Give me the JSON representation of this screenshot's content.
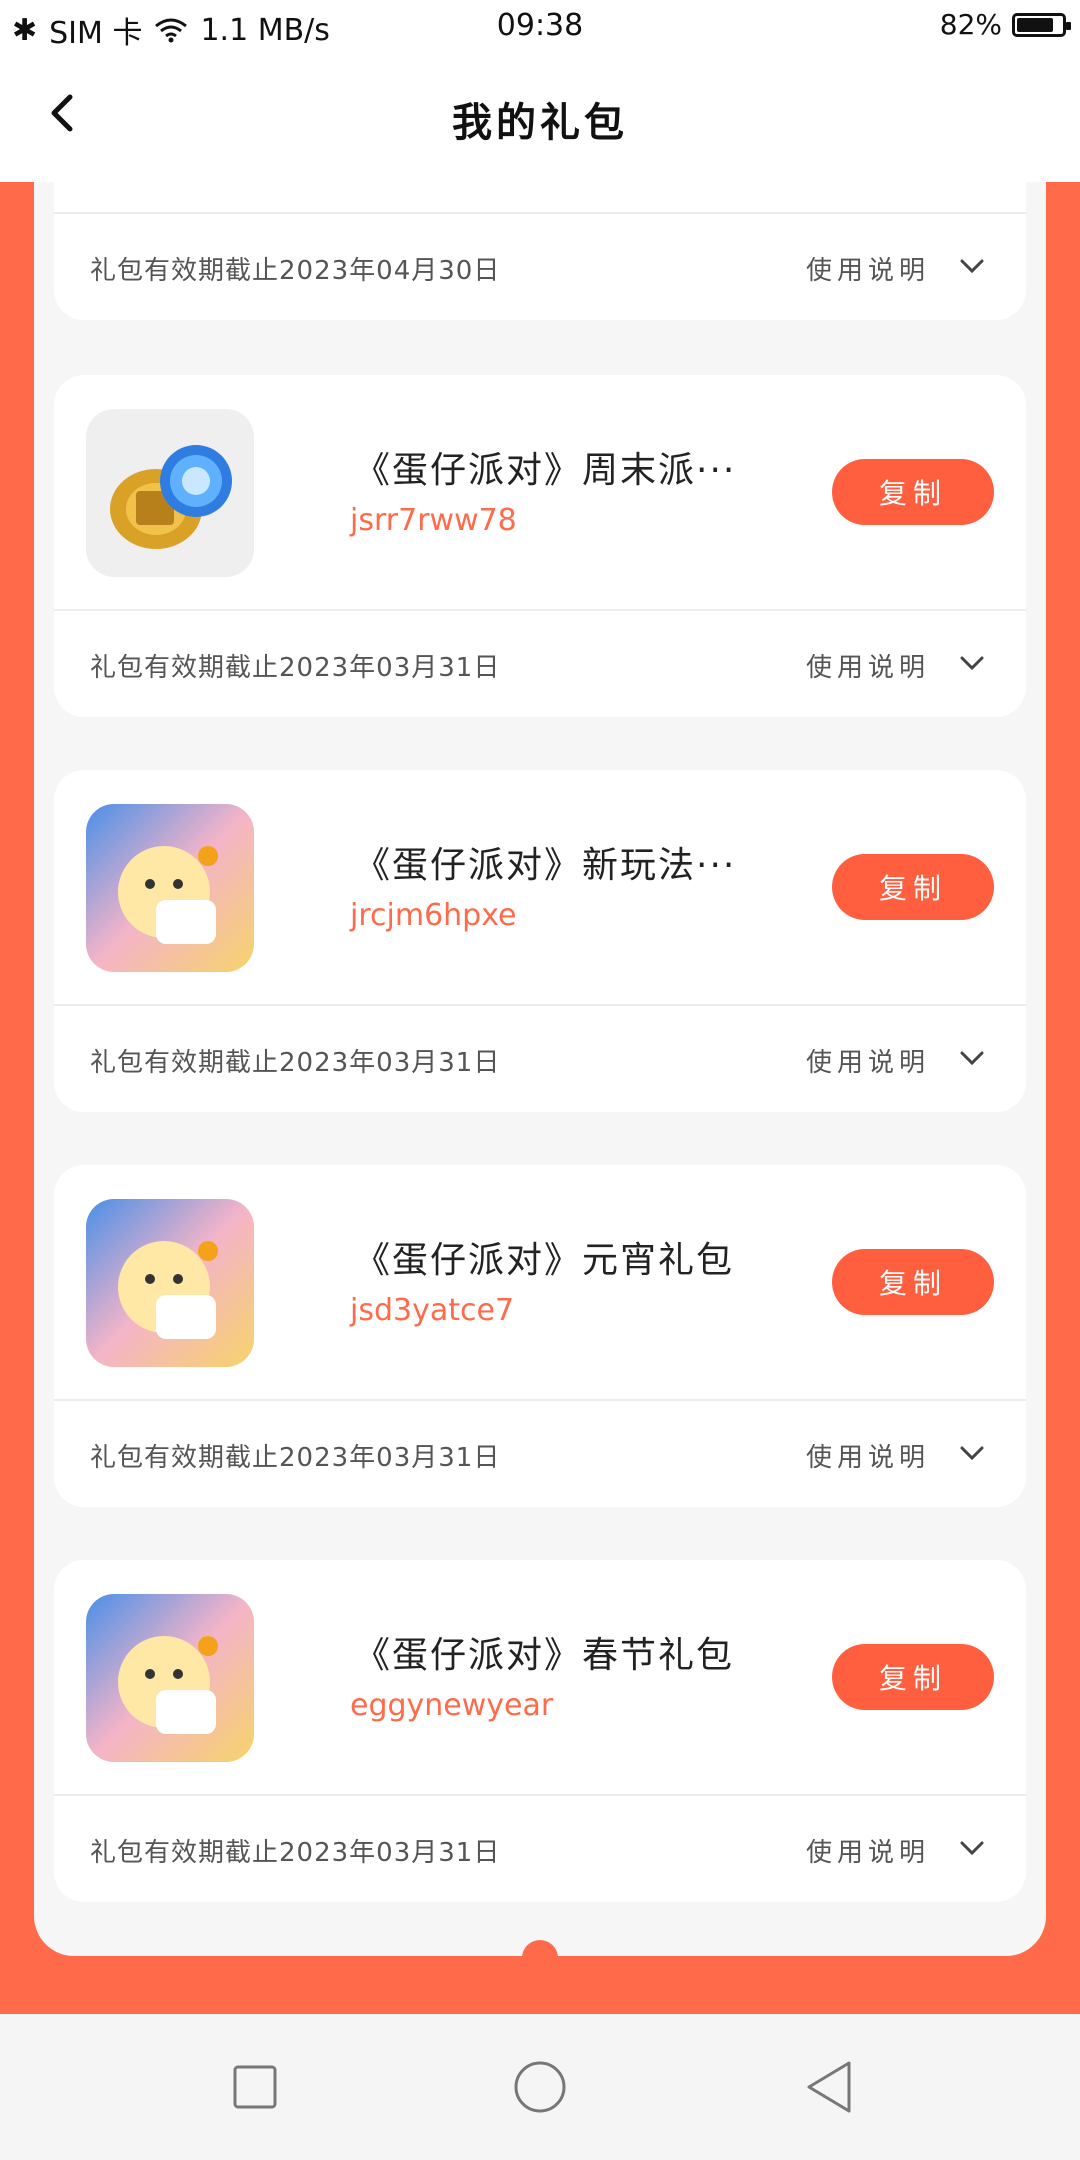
{
  "status_bar": {
    "sim": "SIM 卡",
    "speed": "1.1 MB/s",
    "time": "09:38",
    "battery_text": "82%",
    "battery_level": 0.82
  },
  "header": {
    "title": "我的礼包"
  },
  "first_card": {
    "expiry": "礼包有效期截止2023年04月30日",
    "usage": "使用说明"
  },
  "gifts": [
    {
      "icon": "gold-gear-crystal-icon",
      "title": "《蛋仔派对》周末派···",
      "code": "jsrr7rww78",
      "copy_label": "复制",
      "expiry": "礼包有效期截止2023年03月31日",
      "usage": "使用说明"
    },
    {
      "icon": "eggy-party-game-icon",
      "title": "《蛋仔派对》新玩法···",
      "code": "jrcjm6hpxe",
      "copy_label": "复制",
      "expiry": "礼包有效期截止2023年03月31日",
      "usage": "使用说明"
    },
    {
      "icon": "eggy-party-game-icon",
      "title": "《蛋仔派对》元宵礼包",
      "code": "jsd3yatce7",
      "copy_label": "复制",
      "expiry": "礼包有效期截止2023年03月31日",
      "usage": "使用说明"
    },
    {
      "icon": "eggy-party-game-icon",
      "title": "《蛋仔派对》春节礼包",
      "code": "eggynewyear",
      "copy_label": "复制",
      "expiry": "礼包有效期截止2023年03月31日",
      "usage": "使用说明"
    }
  ],
  "colors": {
    "accent": "#ff6b4a",
    "button": "#ff5f3f"
  }
}
